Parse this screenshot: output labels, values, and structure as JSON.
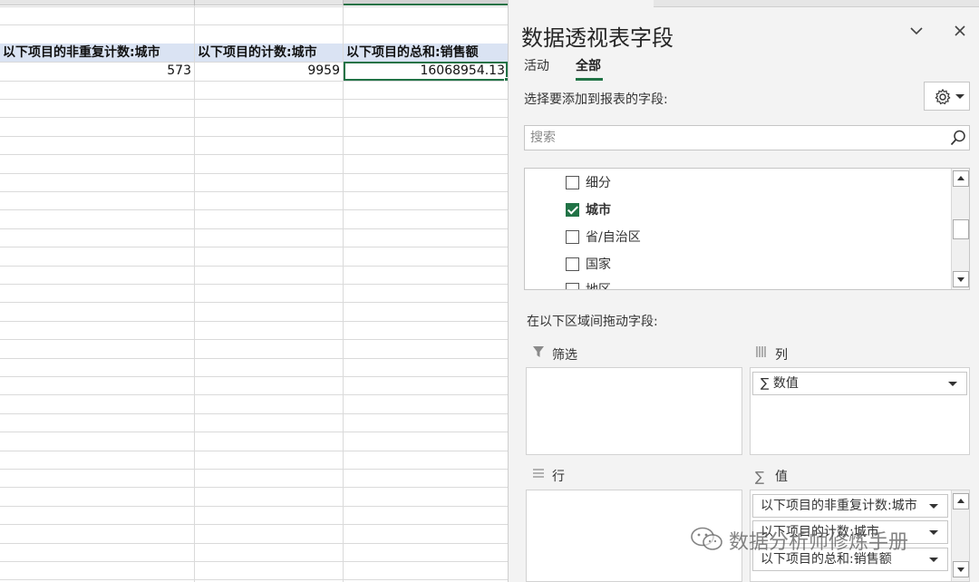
{
  "sheet": {
    "headers": [
      "以下项目的非重复计数:城市",
      "以下项目的计数:城市",
      "以下项目的总和:销售额"
    ],
    "values": [
      "573",
      "9959",
      "16068954.13"
    ]
  },
  "pane": {
    "title": "数据透视表字段",
    "tabs": [
      {
        "label": "活动",
        "active": false
      },
      {
        "label": "全部",
        "active": true
      }
    ],
    "choose_label": "选择要添加到报表的字段:",
    "search_placeholder": "搜索",
    "fields": [
      {
        "label": "细分",
        "checked": false
      },
      {
        "label": "城市",
        "checked": true
      },
      {
        "label": "省/自治区",
        "checked": false
      },
      {
        "label": "国家",
        "checked": false
      },
      {
        "label": "地区",
        "checked": false
      }
    ],
    "drag_label": "在以下区域间拖动字段:",
    "areas": {
      "filter": {
        "label": "筛选",
        "items": []
      },
      "columns": {
        "label": "列",
        "items": [
          "数值"
        ]
      },
      "rows": {
        "label": "行",
        "items": []
      },
      "values": {
        "label": "值",
        "items": [
          "以下项目的非重复计数:城市",
          "以下项目的计数:城市",
          "以下项目的总和:销售额"
        ]
      }
    }
  },
  "watermark": "数据分析师修炼手册",
  "colors": {
    "accent": "#217346",
    "header_fill": "#dae3f3"
  },
  "icons": [
    "gear-icon",
    "search-icon",
    "filter-icon",
    "columns-icon",
    "rows-icon",
    "sigma-icon",
    "chevron-down-icon",
    "close-icon",
    "wechat-icon"
  ]
}
